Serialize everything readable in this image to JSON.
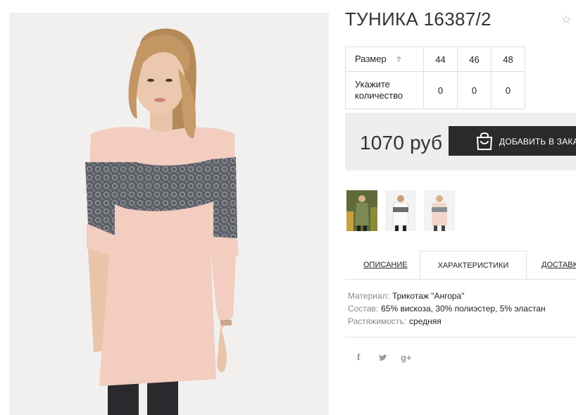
{
  "product": {
    "title": "ТУНИКА 16387/2",
    "favorite_icon": "star-outline-icon",
    "favorite_glyph": "☆"
  },
  "sizes": {
    "size_label": "Размер",
    "help_mark": "?",
    "sizes": [
      "44",
      "46",
      "48"
    ],
    "qty_label": "Укажите количество",
    "quantities": [
      "0",
      "0",
      "0"
    ]
  },
  "purchase": {
    "price": "1070 руб",
    "add_button_label": "ДОБАВИТЬ В ЗАКАЗ",
    "bag_icon": "shopping-bag-icon",
    "button_color": "#2b2b2b"
  },
  "gallery": {
    "thumbnails": [
      "green-tunic-photo",
      "white-grey-tunic-photo",
      "pink-tunic-photo"
    ]
  },
  "tabs": [
    {
      "label": "ОПИСАНИЕ",
      "active": false
    },
    {
      "label": "ХАРАКТЕРИСТИКИ",
      "active": true
    },
    {
      "label": "ДОСТАВКА",
      "active": false
    }
  ],
  "specs": [
    {
      "key": "Материал:",
      "value": "Трикотаж \"Ангора\""
    },
    {
      "key": "Состав:",
      "value": "65% вискоза, 30% полиэстер, 5% эластан"
    },
    {
      "key": "Растяжимость:",
      "value": "средняя"
    }
  ],
  "social": [
    {
      "icon": "facebook-icon",
      "glyph": "f"
    },
    {
      "icon": "twitter-icon",
      "glyph": "t"
    },
    {
      "icon": "google-plus-icon",
      "glyph": "g+"
    }
  ]
}
